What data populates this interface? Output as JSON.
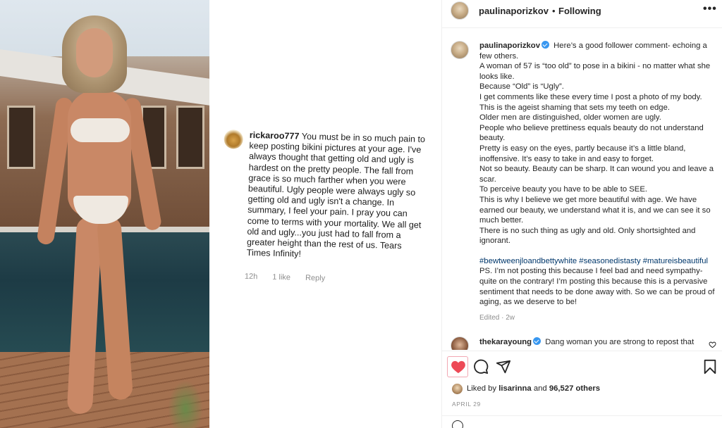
{
  "header": {
    "username": "paulinaporizkov",
    "separator": "•",
    "follow_label": "Following",
    "more_icon": "more-horizontal-icon"
  },
  "media": {
    "overlay_comment": {
      "username": "rickaroo777",
      "text": "You must be in so much pain to keep posting bikini pictures at your age.  I've always thought that getting old and ugly is hardest on the pretty people.  The fall from grace is so much farther when you were beautiful.  Ugly people were always ugly so getting old and ugly isn't a change.  In summary, I feel your pain.  I pray you can come to terms with your mortality.  We all get old and ugly...you just had to fall from a greater height than the rest of us.  Tears Times Infinity!",
      "time": "12h",
      "likes": "1 like",
      "reply": "Reply"
    }
  },
  "caption": {
    "username": "paulinaporizkov",
    "lines": [
      "Here’s a good follower comment- echoing a few others.",
      "A woman of 57 is “too old” to pose in a bikini - no matter what she looks like.",
      "Because “Old” is “Ugly”.",
      "I get comments like these every time I post a photo of my body.",
      "This is the ageist shaming that sets my teeth on edge.",
      "Older men are distinguished, older women are ugly.",
      "People who believe prettiness equals beauty do not understand beauty.",
      "Pretty is easy on the eyes, partly because it’s a little bland, inoffensive. It’s easy to take in and easy to forget.",
      "Not so beauty. Beauty can be sharp. It can wound you and leave a scar.",
      "To perceive beauty you have to be able to SEE.",
      "This is why I believe we get more beautiful with age. We have earned our beauty, we understand what it is, and we can see it so much better.",
      "There is no such thing as ugly and old. Only shortsighted and ignorant."
    ],
    "hashtags": "#bewtweenjloandbettywhite #seasonedistasty #matureisbeautiful",
    "tail": " PS. I’m not posting this because I feel bad and need sympathy- quite on the contrary! I’m posting this because this is a pervasive sentiment that needs to be done away with. So we can be proud of aging, as we deserve to be!",
    "edited": "Edited · 2w"
  },
  "comments": [
    {
      "username": "thekarayoung",
      "text": "Dang woman you are strong to repost that"
    }
  ],
  "actions": {
    "like_icon": "heart-filled-icon",
    "comment_icon": "comment-icon",
    "share_icon": "share-icon",
    "save_icon": "bookmark-icon",
    "like_color": "#ed4956"
  },
  "likes": {
    "prefix": "Liked by ",
    "user": "lisarinna",
    "middle": " and ",
    "count": "96,527 others"
  },
  "date": "APRIL 29"
}
